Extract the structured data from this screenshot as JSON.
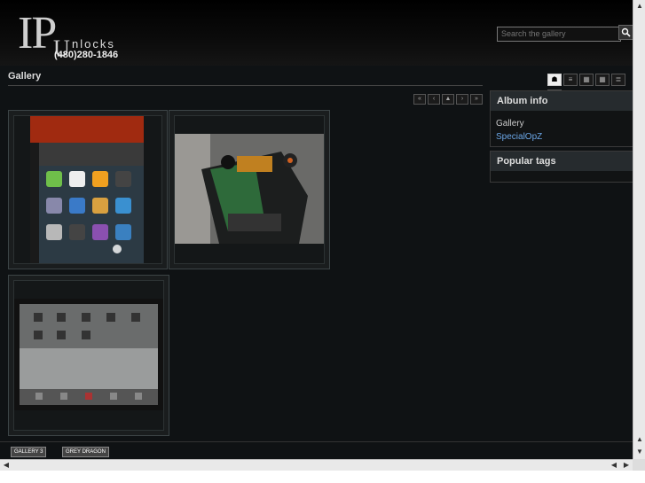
{
  "header": {
    "logo_big": "IP",
    "logo_u": "U",
    "logo_nlocks": "nlocks",
    "logo_phone": "(480)280-1846"
  },
  "search": {
    "placeholder": "Search the gallery"
  },
  "main": {
    "title": "Gallery"
  },
  "sidebar": {
    "album_info": {
      "title": "Album info",
      "items": [
        "Gallery",
        "SpecialOpZ"
      ]
    },
    "popular_tags": {
      "title": "Popular tags"
    }
  },
  "footer": {
    "badge1": "GALLERY 3",
    "badge2": "GREY DRAGON"
  },
  "colors": {
    "link": "#6ba6e6",
    "accent_box": "#262b2e"
  }
}
